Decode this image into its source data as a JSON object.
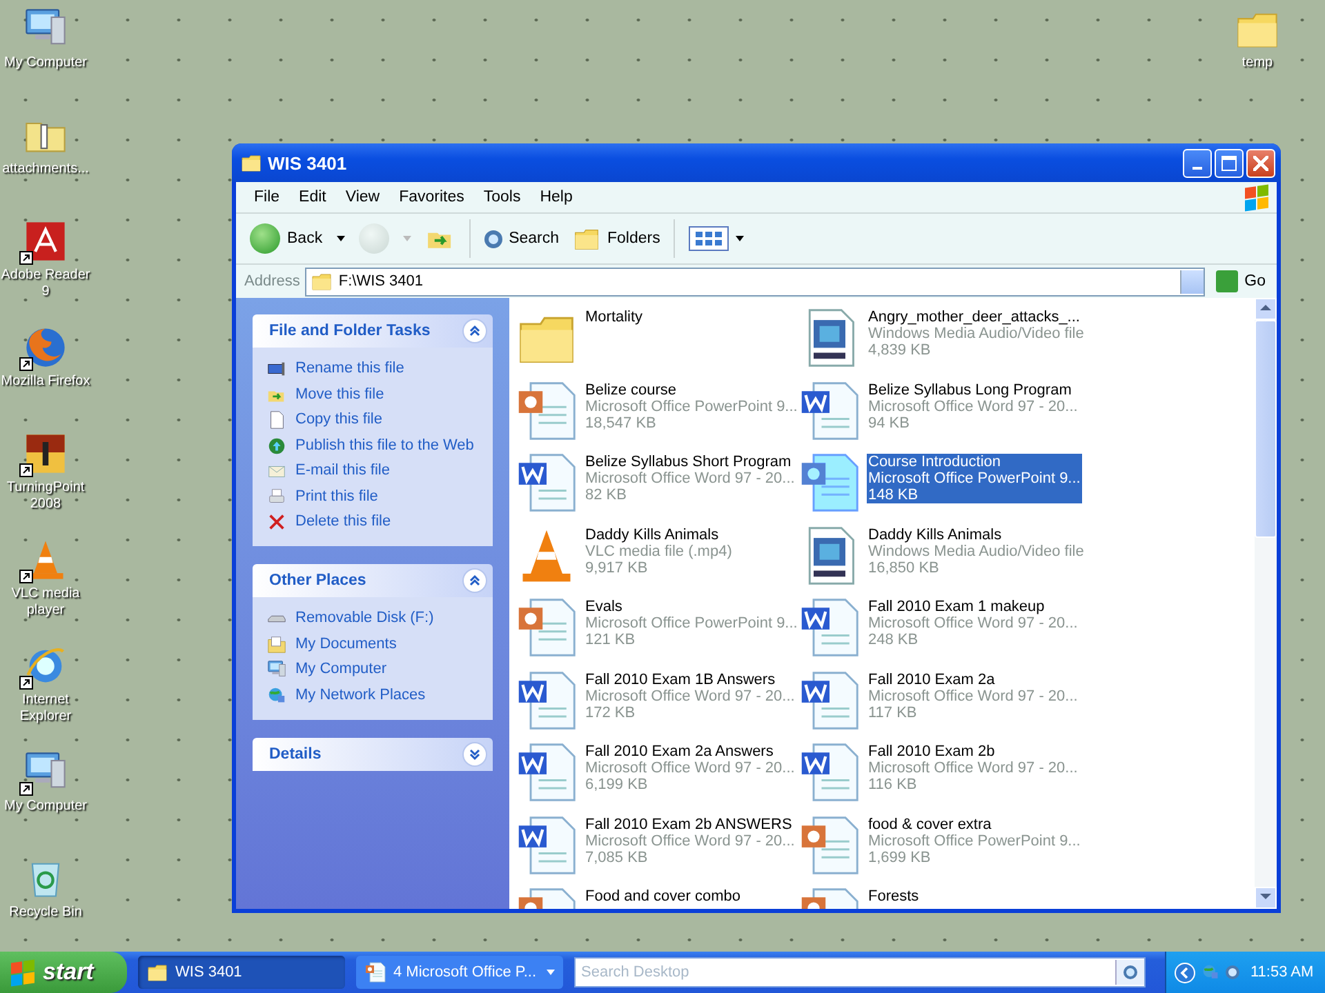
{
  "desktop_icons": [
    {
      "label": "My Computer",
      "kind": "computer",
      "shortcut": false
    },
    {
      "label": "attachments...",
      "kind": "zip",
      "shortcut": false
    },
    {
      "label": "Adobe Reader 9",
      "kind": "pdf",
      "shortcut": true
    },
    {
      "label": "Mozilla Firefox",
      "kind": "firefox",
      "shortcut": true
    },
    {
      "label": "TurningPoint 2008",
      "kind": "turningpoint",
      "shortcut": true
    },
    {
      "label": "VLC media player",
      "kind": "vlc",
      "shortcut": true
    },
    {
      "label": "Internet Explorer",
      "kind": "ie",
      "shortcut": true
    },
    {
      "label": "My Computer",
      "kind": "computer",
      "shortcut": true
    },
    {
      "label": "Recycle Bin",
      "kind": "recycle",
      "shortcut": false
    }
  ],
  "desktop_icons_right": [
    {
      "label": "temp",
      "kind": "folder",
      "shortcut": false
    }
  ],
  "window": {
    "title": "WIS 3401",
    "menu": [
      "File",
      "Edit",
      "View",
      "Favorites",
      "Tools",
      "Help"
    ],
    "toolbar": {
      "back": "Back",
      "forward_disabled": true,
      "search": "Search",
      "folders": "Folders"
    },
    "address": {
      "label": "Address",
      "value": "F:\\WIS 3401",
      "go": "Go"
    },
    "task_panels": [
      {
        "title": "File and Folder Tasks",
        "expanded": true,
        "items": [
          {
            "label": "Rename this file",
            "kind": "rename"
          },
          {
            "label": "Move this file",
            "kind": "move"
          },
          {
            "label": "Copy this file",
            "kind": "copy"
          },
          {
            "label": "Publish this file to the Web",
            "kind": "web"
          },
          {
            "label": "E-mail this file",
            "kind": "email"
          },
          {
            "label": "Print this file",
            "kind": "print"
          },
          {
            "label": "Delete this file",
            "kind": "delete"
          }
        ]
      },
      {
        "title": "Other Places",
        "expanded": true,
        "items": [
          {
            "label": "Removable Disk (F:)",
            "kind": "disk"
          },
          {
            "label": "My Documents",
            "kind": "documents"
          },
          {
            "label": "My Computer",
            "kind": "computer"
          },
          {
            "label": "My Network Places",
            "kind": "network"
          }
        ]
      },
      {
        "title": "Details",
        "expanded": false
      }
    ],
    "files": [
      {
        "name": "Mortality",
        "kind": "folder",
        "selected": false
      },
      {
        "name": "Angry_mother_deer_attacks_...",
        "type": "Windows Media Audio/Video file",
        "size": "4,839 KB",
        "kind": "wmv",
        "selected": false
      },
      {
        "name": "Belize course",
        "type": "Microsoft Office PowerPoint 9...",
        "size": "18,547 KB",
        "kind": "ppt",
        "selected": false
      },
      {
        "name": "Belize Syllabus Long Program",
        "type": "Microsoft Office Word 97 - 20...",
        "size": "94 KB",
        "kind": "word",
        "selected": false
      },
      {
        "name": "Belize Syllabus Short Program",
        "type": "Microsoft Office Word 97 - 20...",
        "size": "82 KB",
        "kind": "word",
        "selected": false
      },
      {
        "name": "Course Introduction",
        "type": "Microsoft Office PowerPoint 9...",
        "size": "148 KB",
        "kind": "ppt",
        "selected": true
      },
      {
        "name": "Daddy Kills Animals",
        "type": "VLC media file (.mp4)",
        "size": "9,917 KB",
        "kind": "vlc",
        "selected": false
      },
      {
        "name": "Daddy Kills Animals",
        "type": "Windows Media Audio/Video file",
        "size": "16,850 KB",
        "kind": "wmv",
        "selected": false
      },
      {
        "name": "Evals",
        "type": "Microsoft Office PowerPoint 9...",
        "size": "121 KB",
        "kind": "ppt",
        "selected": false
      },
      {
        "name": "Fall 2010 Exam 1 makeup",
        "type": "Microsoft Office Word 97 - 20...",
        "size": "248 KB",
        "kind": "word",
        "selected": false
      },
      {
        "name": "Fall 2010 Exam 1B Answers",
        "type": "Microsoft Office Word 97 - 20...",
        "size": "172 KB",
        "kind": "word",
        "selected": false
      },
      {
        "name": "Fall 2010 Exam 2a",
        "type": "Microsoft Office Word 97 - 20...",
        "size": "117 KB",
        "kind": "word",
        "selected": false
      },
      {
        "name": "Fall 2010 Exam 2a Answers",
        "type": "Microsoft Office Word 97 - 20...",
        "size": "6,199 KB",
        "kind": "word",
        "selected": false
      },
      {
        "name": "Fall 2010 Exam 2b",
        "type": "Microsoft Office Word 97 - 20...",
        "size": "116 KB",
        "kind": "word",
        "selected": false
      },
      {
        "name": "Fall 2010 Exam 2b ANSWERS",
        "type": "Microsoft Office Word 97 - 20...",
        "size": "7,085 KB",
        "kind": "word",
        "selected": false
      },
      {
        "name": "food & cover extra",
        "type": "Microsoft Office PowerPoint 9...",
        "size": "1,699 KB",
        "kind": "ppt",
        "selected": false
      },
      {
        "name": "Food and cover combo",
        "kind": "ppt",
        "selected": false
      },
      {
        "name": "Forests",
        "kind": "ppt",
        "selected": false
      }
    ]
  },
  "taskbar": {
    "start": "start",
    "tasks": [
      {
        "label": "WIS 3401",
        "kind": "folder",
        "selected": true,
        "grouped": false
      },
      {
        "label": "4 Microsoft Office P...",
        "kind": "ppt",
        "selected": false,
        "grouped": true
      }
    ],
    "search": {
      "placeholder": "Search Desktop"
    },
    "clock": "11:53 AM"
  }
}
